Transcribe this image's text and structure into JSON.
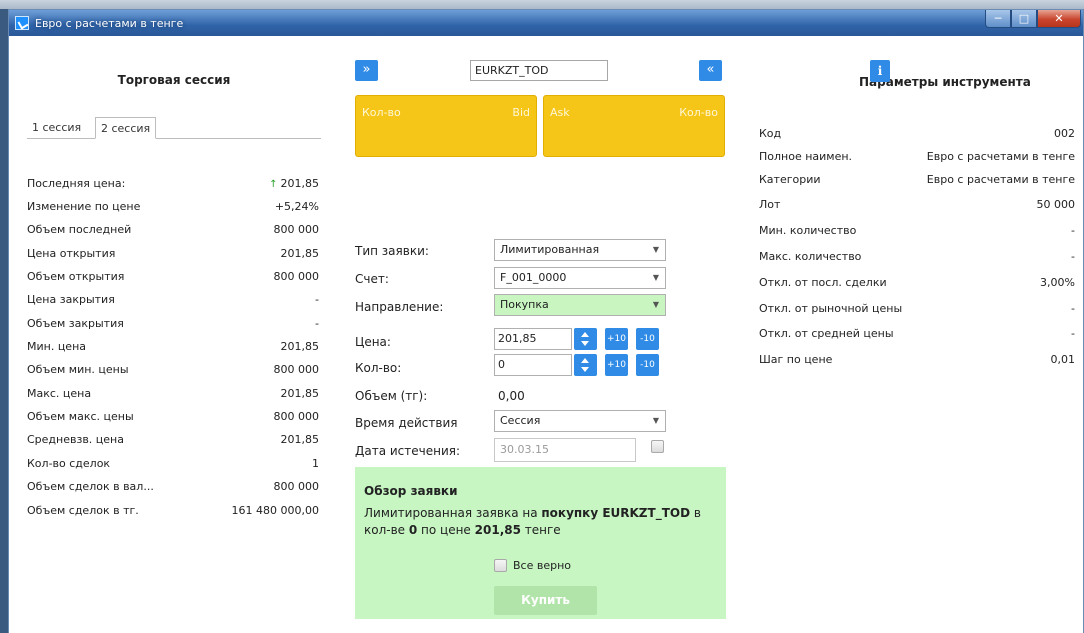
{
  "window": {
    "title": "Евро с расчетами в тенге"
  },
  "left": {
    "title": "Торговая сессия",
    "tabs": [
      {
        "label": "1 сессия"
      },
      {
        "label": "2 сессия"
      }
    ],
    "rows": [
      {
        "label": "Последняя цена:",
        "value": "201,85"
      },
      {
        "label": "Изменение по цене",
        "value": "+5,24%"
      },
      {
        "label": "Объем последней",
        "value": "800 000"
      },
      {
        "label": "Цена открытия",
        "value": "201,85"
      },
      {
        "label": "Объем открытия",
        "value": "800 000"
      },
      {
        "label": "Цена закрытия",
        "value": "-"
      },
      {
        "label": "Объем закрытия",
        "value": "-"
      },
      {
        "label": "Мин. цена",
        "value": "201,85"
      },
      {
        "label": "Объем мин. цены",
        "value": "800 000"
      },
      {
        "label": "Макс. цена",
        "value": "201,85"
      },
      {
        "label": "Объем макс. цены",
        "value": "800 000"
      },
      {
        "label": "Средневзв. цена",
        "value": "201,85"
      },
      {
        "label": "Кол-во сделок",
        "value": "1"
      },
      {
        "label": "Объем сделок в вал...",
        "value": "800 000"
      },
      {
        "label": "Объем сделок в тг.",
        "value": "161 480 000,00"
      }
    ]
  },
  "center": {
    "ticker": "EURKZT_TOD",
    "quote": {
      "bid_qty_label": "Кол-во",
      "bid_label": "Bid",
      "ask_label": "Ask",
      "ask_qty_label": "Кол-во"
    },
    "form": {
      "order_type_label": "Тип заявки:",
      "order_type_value": "Лимитированная",
      "account_label": "Счет:",
      "account_value": "F_001_0000",
      "direction_label": "Направление:",
      "direction_value": "Покупка",
      "price_label": "Цена:",
      "price_value": "201,85",
      "qty_label": "Кол-во:",
      "qty_value": "0",
      "plus_label": "+10",
      "minus_label": "-10",
      "volume_label": "Объем (тг):",
      "volume_value": "0,00",
      "duration_label": "Время действия",
      "duration_value": "Сессия",
      "expiry_label": "Дата истечения:",
      "expiry_value": "30.03.15"
    },
    "review": {
      "title": "Обзор заявки",
      "text_1": "Лимитированная заявка на ",
      "text_bold_1": "покупку EURKZT_TOD",
      "text_2": " в кол-ве ",
      "text_bold_2": "0",
      "text_3": " по цене ",
      "text_bold_3": "201,85",
      "text_4": " тенге",
      "confirm_label": "Все верно",
      "buy_label": "Купить"
    }
  },
  "right": {
    "title": "Параметры инструмента",
    "info_label": "i",
    "rows": [
      {
        "label": "Код",
        "value": "002"
      },
      {
        "label": "Полное наимен.",
        "value": "Евро с расчетами в тенге"
      },
      {
        "label": "Категории",
        "value": "Евро с расчетами в тенге"
      },
      {
        "label": "Лот",
        "value": "50 000"
      },
      {
        "label": "Мин. количество",
        "value": "-"
      },
      {
        "label": "Макс. количество",
        "value": "-"
      },
      {
        "label": "Откл. от посл. сделки",
        "value": "3,00%"
      },
      {
        "label": "Откл. от рыночной цены",
        "value": "-"
      },
      {
        "label": "Откл. от средней цены",
        "value": "-"
      },
      {
        "label": "Шаг по цене",
        "value": "0,01"
      }
    ]
  },
  "colors": {
    "accent": "#2f8be6",
    "quote_box": "#f5c518",
    "review_bg": "#c7f6c3",
    "direction_bg": "#c8f5c0",
    "up_arrow": "#2ca02c"
  }
}
